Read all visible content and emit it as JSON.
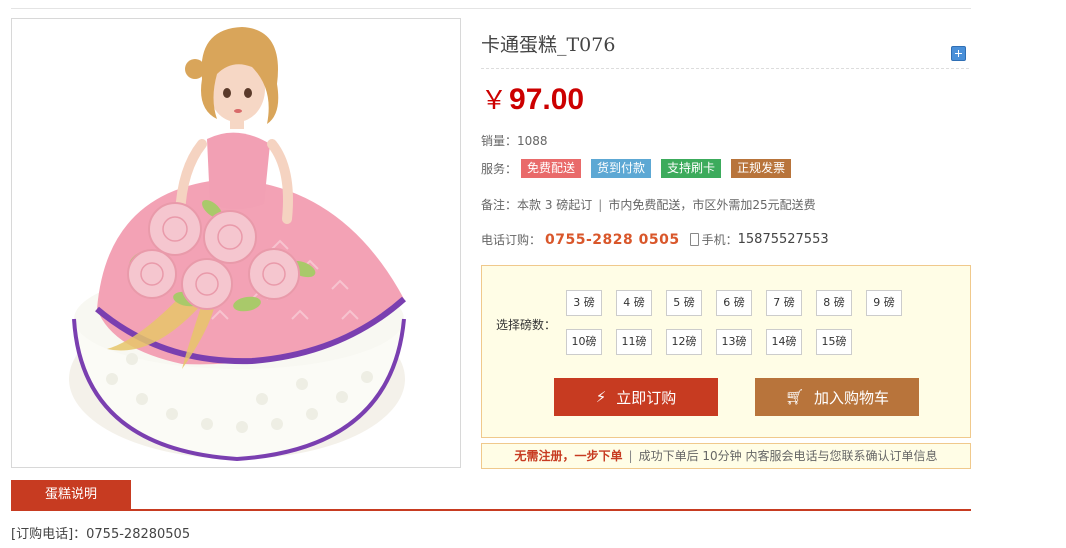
{
  "product": {
    "title": "卡通蛋糕_T076",
    "currency": "￥",
    "price": "97.00",
    "sales_label": "销量：",
    "sales_count": "1088",
    "services_label": "服务：",
    "services": [
      {
        "label": "免费配送",
        "color": "#e96a6a"
      },
      {
        "label": "货到付款",
        "color": "#5da8d4"
      },
      {
        "label": "支持刷卡",
        "color": "#3cab5c"
      },
      {
        "label": "正规发票",
        "color": "#b8743b"
      }
    ],
    "note_label": "备注：",
    "note_text_1": "本款 3 磅起订",
    "note_sep": "|",
    "note_text_2": "市内免费配送，市区外需加25元配送费",
    "phone_label": "电话订购：",
    "phone_number": "0755-2828 0505",
    "mobile_label": "手机：",
    "mobile_number": "15875527553"
  },
  "weights": {
    "label": "选择磅数：",
    "row1": [
      "3 磅",
      "4 磅",
      "5 磅",
      "6 磅",
      "7 磅",
      "8 磅",
      "9 磅"
    ],
    "row2": [
      "10磅",
      "11磅",
      "12磅",
      "13磅",
      "14磅",
      "15磅"
    ]
  },
  "buttons": {
    "buy_label": "立即订购",
    "cart_label": "加入购物车"
  },
  "notice": {
    "highlight": "无需注册，一步下单",
    "sep": "|",
    "text": "成功下单后 10分钟 内客服会电话与您联系确认订单信息"
  },
  "tab": {
    "label": "蛋糕说明"
  },
  "order_phone": "[订购电话]：0755-28280505",
  "colors": {
    "accent": "#c73b21",
    "price": "#cc0000",
    "cart": "#b8743b"
  }
}
